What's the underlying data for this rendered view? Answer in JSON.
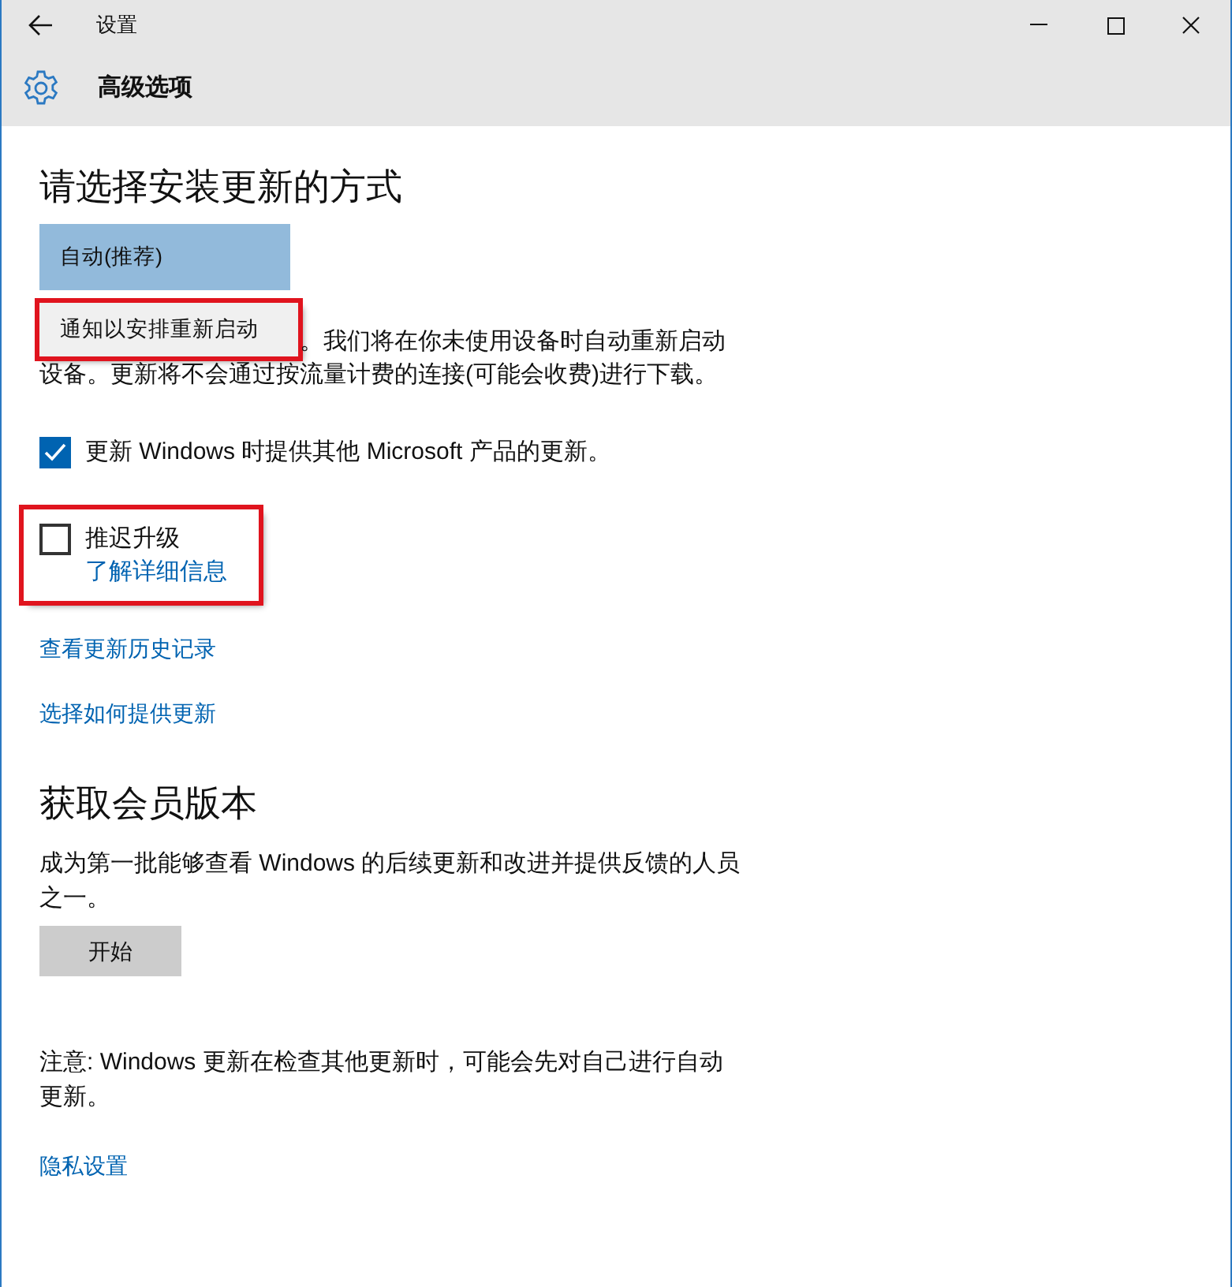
{
  "window": {
    "title": "设置"
  },
  "header": {
    "title": "高级选项"
  },
  "install": {
    "heading": "请选择安装更新的方式",
    "options": [
      {
        "label": "自动(推荐)",
        "selected": true,
        "highlighted": false
      },
      {
        "label": "通知以安排重新启动",
        "selected": false,
        "highlighted": true
      }
    ],
    "description_lines": [
      "。我们将在你未使用设备时自动重新启动",
      "设备。更新将不会通过按流量计费的连接(可能会收费)进行下载。"
    ]
  },
  "checkboxes": [
    {
      "label": "更新 Windows 时提供其他 Microsoft 产品的更新。",
      "checked": true,
      "highlighted": false
    },
    {
      "label": "推迟升级",
      "checked": false,
      "highlighted": true,
      "link": "了解详细信息"
    }
  ],
  "links": [
    "查看更新历史记录",
    "选择如何提供更新"
  ],
  "insider": {
    "heading": "获取会员版本",
    "text": "成为第一批能够查看 Windows 的后续更新和改进并提供反馈的人员之一。",
    "button": "开始"
  },
  "note": "注意: Windows 更新在检查其他更新时，可能会先对自己进行自动更新。",
  "privacy_link": "隐私设置"
}
